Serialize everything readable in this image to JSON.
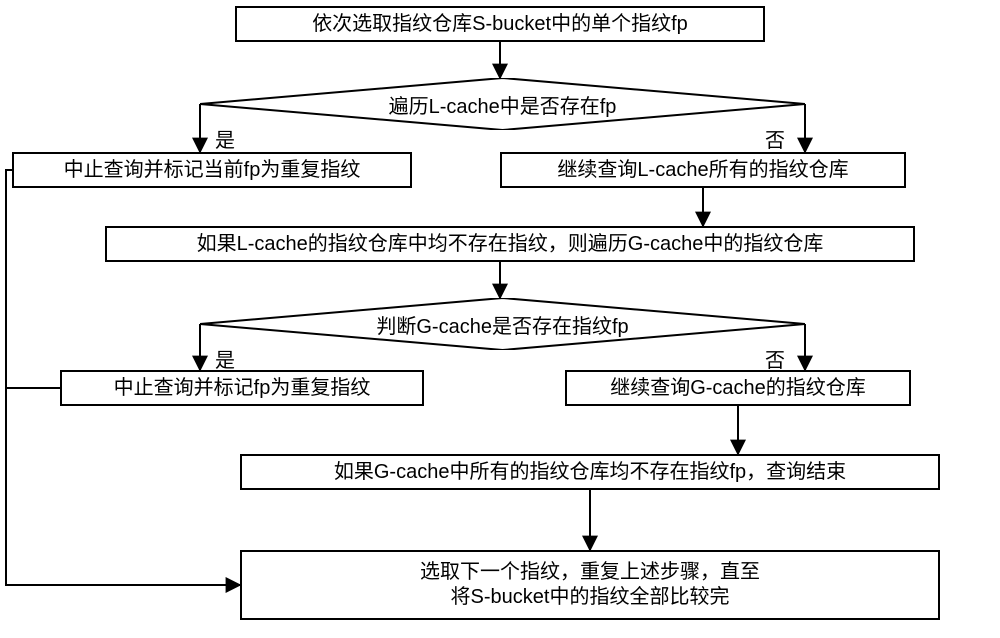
{
  "boxes": {
    "start": "依次选取指纹仓库S-bucket中的单个指纹fp",
    "stop1": "中止查询并标记当前fp为重复指纹",
    "continueL": "继续查询L-cache所有的指纹仓库",
    "checkG": "如果L-cache的指纹仓库中均不存在指纹，则遍历G-cache中的指纹仓库",
    "stop2": "中止查询并标记fp为重复指纹",
    "continueG": "继续查询G-cache的指纹仓库",
    "endQuery": "如果G-cache中所有的指纹仓库均不存在指纹fp，查询结束",
    "next_l1": "选取下一个指纹，重复上述步骤，直至",
    "next_l2": "将S-bucket中的指纹全部比较完"
  },
  "decisions": {
    "d1": "遍历L-cache中是否存在fp",
    "d2": "判断G-cache是否存在指纹fp"
  },
  "labels": {
    "yes": "是",
    "no": "否"
  }
}
